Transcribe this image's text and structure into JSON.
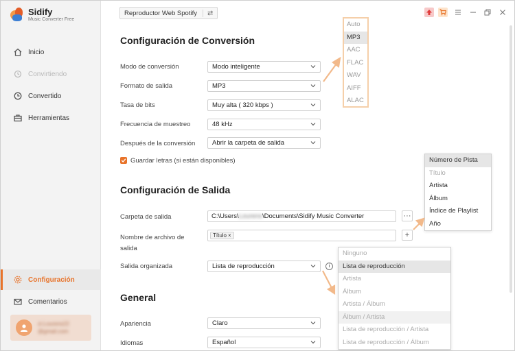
{
  "app": {
    "name": "Sidify",
    "subtitle": "Music Converter Free"
  },
  "sidebar": {
    "items": [
      {
        "label": "Inicio",
        "icon": "home-icon"
      },
      {
        "label": "Convirtiendo",
        "icon": "converting-icon"
      },
      {
        "label": "Convertido",
        "icon": "clock-icon"
      },
      {
        "label": "Herramientas",
        "icon": "toolbox-icon"
      },
      {
        "label": "Configuración",
        "icon": "gear-icon"
      },
      {
        "label": "Comentarios",
        "icon": "mail-icon"
      }
    ],
    "user": {
      "name": "zi.Lourens22",
      "email": "@gmail.com"
    }
  },
  "topbar": {
    "source_label": "Reproductor Web Spotify",
    "swap_symbol": "⇄"
  },
  "conversion": {
    "title": "Configuración de Conversión",
    "mode": {
      "label": "Modo de conversión",
      "value": "Modo inteligente"
    },
    "format": {
      "label": "Formato de salida",
      "value": "MP3"
    },
    "bitrate": {
      "label": "Tasa de bits",
      "value": "Muy alta ( 320 kbps )"
    },
    "samplerate": {
      "label": "Frecuencia de muestreo",
      "value": "48 kHz"
    },
    "after": {
      "label": "Después de la conversión",
      "value": "Abrir la carpeta de salida"
    },
    "lyrics": {
      "label": "Guardar letras (si están disponibles)"
    }
  },
  "format_options": [
    "Auto",
    "MP3",
    "AAC",
    "FLAC",
    "WAV",
    "AIFF",
    "ALAC"
  ],
  "output": {
    "title": "Configuración de Salida",
    "folder": {
      "label": "Carpeta de salida",
      "prefix": "C:\\Users\\",
      "user": "Lourens",
      "suffix": "\\Documents\\Sidify Music Converter",
      "browse": "···"
    },
    "filename": {
      "label": "Nombre de archivo de",
      "label2": "salida",
      "tag": "Título",
      "tag_remove": "×",
      "add": "+"
    },
    "organized": {
      "label": "Salida organizada",
      "value": "Lista de reproducción",
      "info": "i"
    }
  },
  "tag_options": [
    "Número de Pista",
    "Título",
    "Artista",
    "Álbum",
    "Índice de Playlist",
    "Año"
  ],
  "organize_options": [
    "Ninguno",
    "Lista de reproducción",
    "Artista",
    "Álbum",
    "Artista / Álbum",
    "Álbum / Artista",
    "Lista de reproducción / Artista",
    "Lista de reproducción / Álbum"
  ],
  "general": {
    "title": "General",
    "appearance": {
      "label": "Apariencia",
      "value": "Claro"
    },
    "language": {
      "label": "Idiomas",
      "value": "Español"
    }
  },
  "colors": {
    "accent": "#e8732a",
    "highlight": "#f5cfa9"
  }
}
